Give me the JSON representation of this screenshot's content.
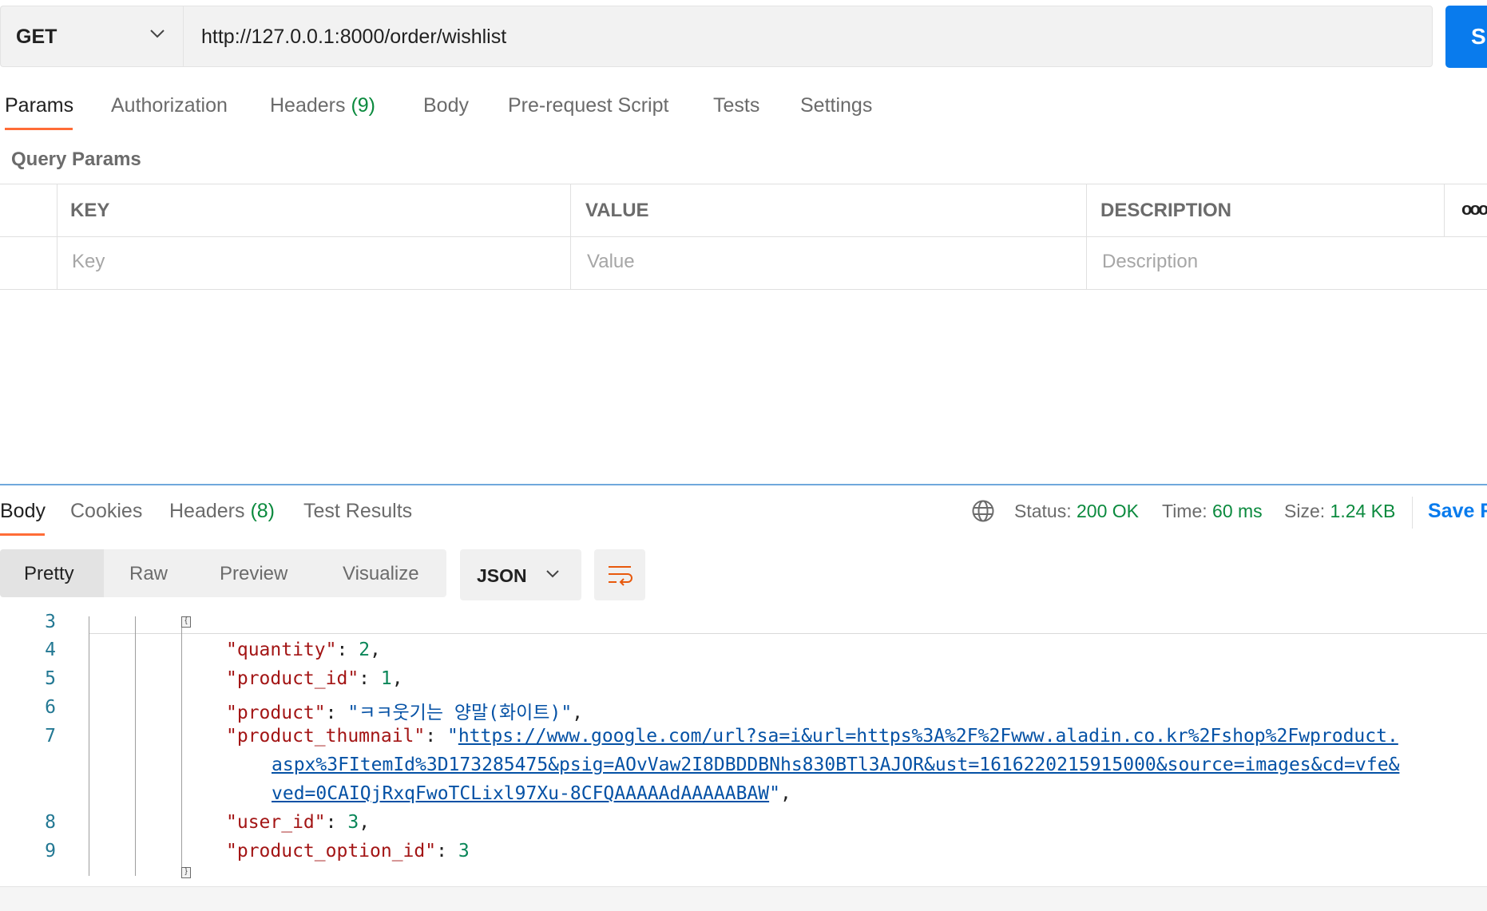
{
  "request": {
    "method": "GET",
    "url": "http://127.0.0.1:8000/order/wishlist",
    "send_label": "S",
    "tabs": [
      {
        "label": "Params",
        "active": true
      },
      {
        "label": "Authorization"
      },
      {
        "label": "Headers",
        "count": "(9)"
      },
      {
        "label": "Body"
      },
      {
        "label": "Pre-request Script"
      },
      {
        "label": "Tests"
      },
      {
        "label": "Settings"
      }
    ],
    "query_params": {
      "title": "Query Params",
      "headers": [
        "KEY",
        "VALUE",
        "DESCRIPTION"
      ],
      "placeholders": [
        "Key",
        "Value",
        "Description"
      ],
      "more_label": "ooo"
    }
  },
  "response": {
    "tabs": [
      {
        "label": "Body",
        "active": true
      },
      {
        "label": "Cookies"
      },
      {
        "label": "Headers",
        "count": "(8)"
      },
      {
        "label": "Test Results"
      }
    ],
    "status_label": "Status:",
    "status_value": "200 OK",
    "time_label": "Time:",
    "time_value": "60 ms",
    "size_label": "Size:",
    "size_value": "1.24 KB",
    "save_label": "Save R",
    "view_modes": [
      "Pretty",
      "Raw",
      "Preview",
      "Visualize"
    ],
    "format": "JSON",
    "code_lines": {
      "n3": "3",
      "n4": "4",
      "n5": "5",
      "n6": "6",
      "n7": "7",
      "n8": "8",
      "n9": "9",
      "k_quantity": "\"quantity\"",
      "v_quantity": "2",
      "k_product_id": "\"product_id\"",
      "v_product_id": "1",
      "k_product": "\"product\"",
      "v_product": "\"ㅋㅋ웃기는 양말(화이트)\"",
      "k_thumb": "\"product_thumnail\"",
      "v_thumb_1": "https://www.google.com/url?sa=i&url=https%3A%2F%2Fwww.aladin.co.kr%2Fshop%2Fwproduct.",
      "v_thumb_2": "aspx%3FItemId%3D173285475&psig=AOvVaw2I8DBDDBNhs830BTl3AJOR&ust=1616220215915000&source=images&cd=vfe&",
      "v_thumb_3": "ved=0CAIQjRxqFwoTCLixl97Xu-8CFQAAAAAdAAAAABAW",
      "k_user_id": "\"user_id\"",
      "v_user_id": "3",
      "k_option": "\"product_option_id\"",
      "v_option": "3"
    }
  }
}
